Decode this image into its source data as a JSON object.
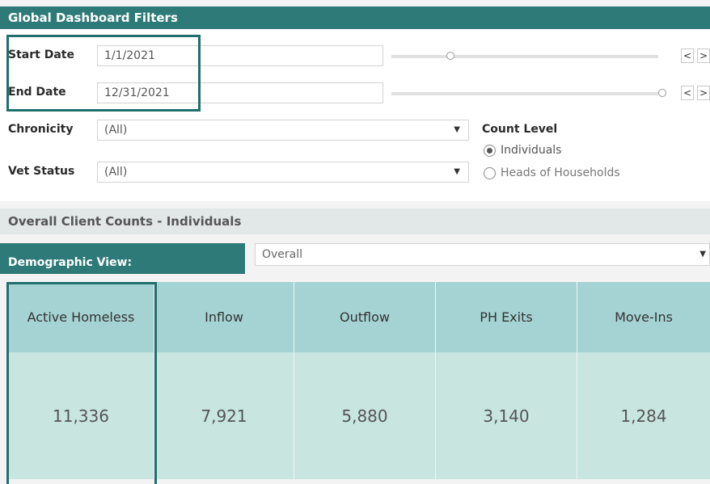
{
  "header": {
    "title": "Global Dashboard Filters"
  },
  "filters": {
    "start_date": {
      "label": "Start Date",
      "value": "1/1/2021"
    },
    "end_date": {
      "label": "End Date",
      "value": "12/31/2021"
    },
    "chronicity": {
      "label": "Chronicity",
      "value": "(All)"
    },
    "vet_status": {
      "label": "Vet Status",
      "value": "(All)"
    },
    "prev_arrow": "<",
    "next_arrow": ">"
  },
  "count_level": {
    "label": "Count Level",
    "options": [
      "Individuals",
      "Heads of Households"
    ],
    "selected": "Individuals"
  },
  "section": {
    "title": "Overall Client Counts - Individuals"
  },
  "demographic": {
    "label": "Demographic View:",
    "value": "Overall"
  },
  "table": {
    "columns": [
      "Active Homeless",
      "Inflow",
      "Outflow",
      "PH Exits",
      "Move-Ins"
    ],
    "values": [
      "11,336",
      "7,921",
      "5,880",
      "3,140",
      "1,284"
    ]
  },
  "colors": {
    "header": "#2e7a78",
    "table_head": "#a5d3d3",
    "table_values": "#c8e5e0",
    "highlight": "#1f6f6d"
  },
  "icons": [
    "dropdown-arrow-icon",
    "radio-icon",
    "prev-arrow-icon",
    "next-arrow-icon",
    "slider-handle-icon"
  ]
}
